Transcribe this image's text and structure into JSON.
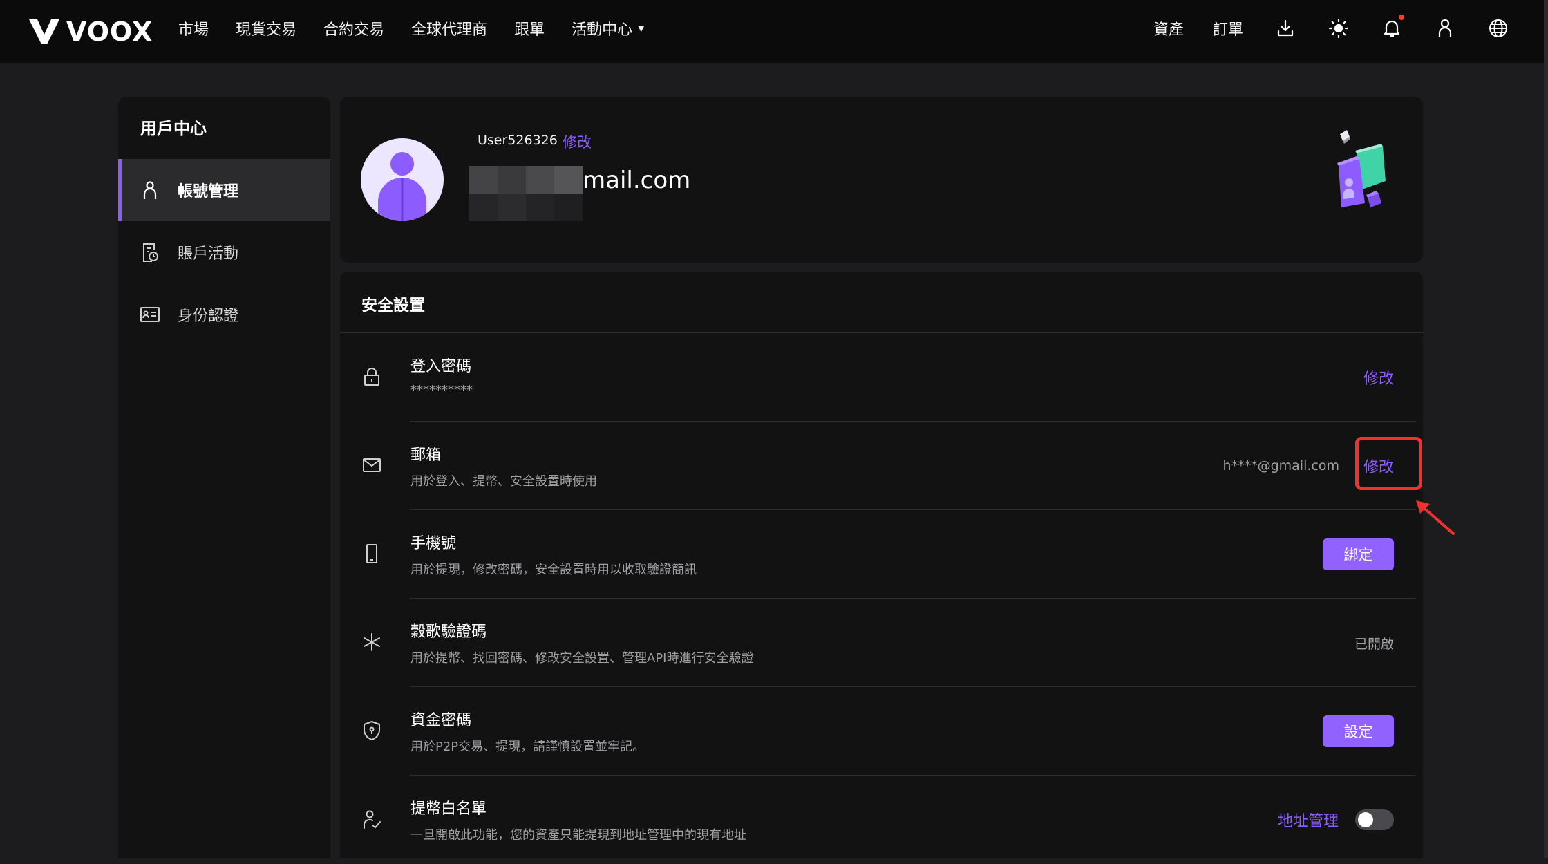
{
  "brand": {
    "name": "VOOX"
  },
  "nav": {
    "items": [
      "市場",
      "現貨交易",
      "合約交易",
      "全球代理商",
      "跟單"
    ],
    "events": "活動中心"
  },
  "header_right": {
    "assets": "資產",
    "orders": "訂單"
  },
  "sidebar": {
    "title": "用戶中心",
    "items": [
      {
        "label": "帳號管理",
        "icon": "user-icon",
        "active": true
      },
      {
        "label": "賬戶活動",
        "icon": "activity-icon"
      },
      {
        "label": "身份認證",
        "icon": "id-card-icon"
      }
    ]
  },
  "profile": {
    "username": "User526326",
    "edit_label": "修改",
    "email_visible": "mail.com"
  },
  "security": {
    "title": "安全設置",
    "rows": [
      {
        "title": "登入密碼",
        "desc": "**********",
        "action": "修改"
      },
      {
        "title": "郵箱",
        "desc": "用於登入、提幣、安全設置時使用",
        "value": "h****@gmail.com",
        "action": "修改"
      },
      {
        "title": "手機號",
        "desc": "用於提現，修改密碼，安全設置時用以收取驗證簡訊",
        "action": "綁定"
      },
      {
        "title": "穀歌驗證碼",
        "desc": "用於提幣、找回密碼、修改安全設置、管理API時進行安全驗證",
        "status": "已開啟"
      },
      {
        "title": "資金密碼",
        "desc": "用於P2P交易、提現，請謹慎設置並牢記。",
        "action": "設定"
      },
      {
        "title": "提幣白名單",
        "desc": "一旦開啟此功能，您的資產只能提現到地址管理中的現有地址",
        "link": "地址管理",
        "toggle_on": false
      }
    ]
  },
  "colors": {
    "accent": "#8d5cff",
    "button": "#9262ff",
    "annotation": "#f0322f"
  }
}
